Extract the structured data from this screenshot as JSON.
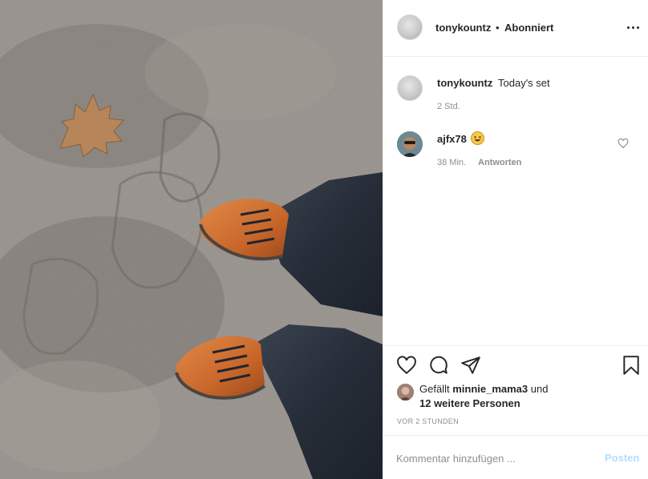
{
  "post": {
    "photo_alt": "",
    "header": {
      "username": "tonykountz",
      "separator": "•",
      "follow_status": "Abonniert",
      "more_icon": "more-horizontal-icon"
    },
    "caption": {
      "username": "tonykountz",
      "text": "Today's set",
      "time": "2 Std."
    },
    "comments": [
      {
        "username": "ajfx78",
        "emoji": "grinning-squinting-face",
        "time": "38 Min.",
        "reply_label": "Antworten",
        "like_icon": "heart-outline-icon"
      }
    ],
    "actions": {
      "like_icon": "heart-outline-icon",
      "comment_icon": "speech-bubble-icon",
      "share_icon": "paper-plane-icon",
      "save_icon": "bookmark-icon"
    },
    "likes": {
      "prefix": "Gefällt",
      "name": "minnie_mama3",
      "and": "und",
      "others": "12 weitere Personen"
    },
    "post_time": "VOR 2 STUNDEN",
    "comment_box": {
      "placeholder": "Kommentar hinzufügen ...",
      "post_label": "Posten",
      "post_color": "#b2dffc"
    }
  }
}
